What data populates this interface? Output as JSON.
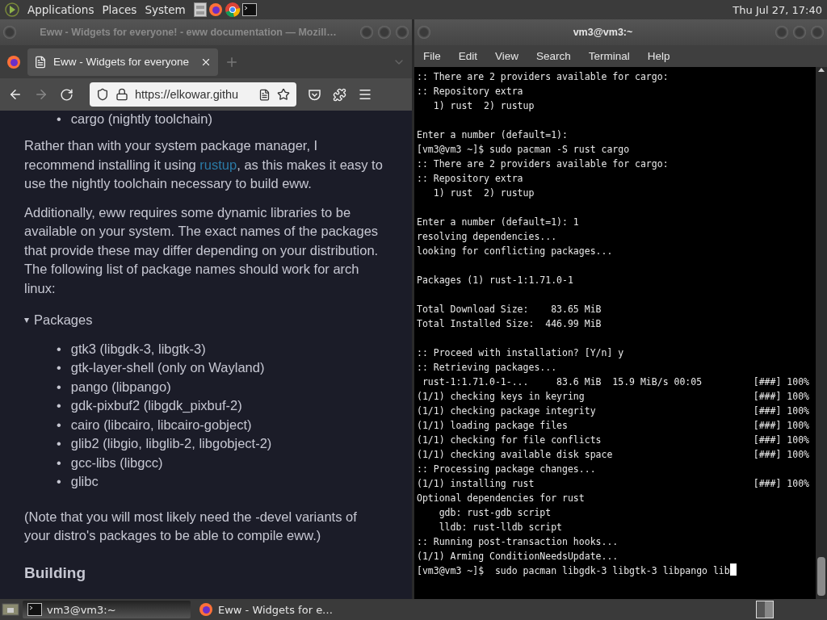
{
  "top_panel": {
    "menus": [
      "Applications",
      "Places",
      "System"
    ],
    "clock": "Thu Jul 27, 17:40"
  },
  "browser": {
    "title": "Eww - Widgets for everyone! - eww documentation — Mozill…",
    "active": false,
    "tab": {
      "label": "Eww - Widgets for everyone",
      "selected": true
    },
    "url": "https://elkowar.githu",
    "content": {
      "cut_item": {
        "marker": "•",
        "text": "cargo (nightly toolchain)"
      },
      "para1": {
        "before": "Rather than with your system package manager, I recommend installing it using ",
        "link": "rustup",
        "after": ", as this makes it easy to use the nightly toolchain necessary to build eww."
      },
      "para2": "Additionally, eww requires some dynamic libraries to be available on your system. The exact names of the packages that provide these may differ depending on your distribution. The following list of package names should work for arch linux:",
      "details": {
        "toggle": "▾",
        "summary": "Packages",
        "expanded": true
      },
      "packages": [
        {
          "marker": "•",
          "text": "gtk3 (libgdk-3, libgtk-3)"
        },
        {
          "marker": "•",
          "text": "gtk-layer-shell (only on Wayland)"
        },
        {
          "marker": "•",
          "text": "pango (libpango)"
        },
        {
          "marker": "•",
          "text": "gdk-pixbuf2 (libgdk_pixbuf-2)"
        },
        {
          "marker": "•",
          "text": "cairo (libcairo, libcairo-gobject)"
        },
        {
          "marker": "•",
          "text": "glib2 (libgio, libglib-2, libgobject-2)"
        },
        {
          "marker": "•",
          "text": "gcc-libs (libgcc)"
        },
        {
          "marker": "•",
          "text": "glibc"
        }
      ],
      "note": "(Note that you will most likely need the -devel variants of your distro's packages to be able to compile eww.)",
      "heading": "Building"
    }
  },
  "terminal": {
    "title": "vm3@vm3:~",
    "active": true,
    "menus": [
      "File",
      "Edit",
      "View",
      "Search",
      "Terminal",
      "Help"
    ],
    "lines": [
      {
        "kind": "text",
        "text": ":: There are 2 providers available for cargo:"
      },
      {
        "kind": "text",
        "text": ":: Repository extra"
      },
      {
        "kind": "text",
        "text": "   1) rust  2) rustup"
      },
      {
        "kind": "blank"
      },
      {
        "kind": "text",
        "text": "Enter a number (default=1):"
      },
      {
        "kind": "text",
        "text": "[vm3@vm3 ~]$ sudo pacman -S rust cargo"
      },
      {
        "kind": "text",
        "text": ":: There are 2 providers available for cargo:"
      },
      {
        "kind": "text",
        "text": ":: Repository extra"
      },
      {
        "kind": "text",
        "text": "   1) rust  2) rustup"
      },
      {
        "kind": "blank"
      },
      {
        "kind": "text",
        "text": "Enter a number (default=1): 1"
      },
      {
        "kind": "text",
        "text": "resolving dependencies..."
      },
      {
        "kind": "text",
        "text": "looking for conflicting packages..."
      },
      {
        "kind": "blank"
      },
      {
        "kind": "text",
        "text": "Packages (1) rust-1:1.71.0-1"
      },
      {
        "kind": "blank"
      },
      {
        "kind": "text",
        "text": "Total Download Size:    83.65 MiB"
      },
      {
        "kind": "text",
        "text": "Total Installed Size:  446.99 MiB"
      },
      {
        "kind": "blank"
      },
      {
        "kind": "text",
        "text": ":: Proceed with installation? [Y/n] y"
      },
      {
        "kind": "text",
        "text": ":: Retrieving packages..."
      },
      {
        "kind": "progress",
        "text": " rust-1:1.71.0-1-...     83.6 MiB  15.9 MiB/s 00:05",
        "progress": "[###] 100%"
      },
      {
        "kind": "progress",
        "text": "(1/1) checking keys in keyring",
        "progress": "[###] 100%"
      },
      {
        "kind": "progress",
        "text": "(1/1) checking package integrity",
        "progress": "[###] 100%"
      },
      {
        "kind": "progress",
        "text": "(1/1) loading package files",
        "progress": "[###] 100%"
      },
      {
        "kind": "progress",
        "text": "(1/1) checking for file conflicts",
        "progress": "[###] 100%"
      },
      {
        "kind": "progress",
        "text": "(1/1) checking available disk space",
        "progress": "[###] 100%"
      },
      {
        "kind": "text",
        "text": ":: Processing package changes..."
      },
      {
        "kind": "progress",
        "text": "(1/1) installing rust",
        "progress": "[###] 100%"
      },
      {
        "kind": "text",
        "text": "Optional dependencies for rust"
      },
      {
        "kind": "text",
        "text": "    gdb: rust-gdb script"
      },
      {
        "kind": "text",
        "text": "    lldb: rust-lldb script"
      },
      {
        "kind": "text",
        "text": ":: Running post-transaction hooks..."
      },
      {
        "kind": "text",
        "text": "(1/1) Arming ConditionNeedsUpdate..."
      },
      {
        "kind": "prompt",
        "text": "[vm3@vm3 ~]$  sudo pacman libgdk-3 libgtk-3 libpango lib"
      }
    ]
  },
  "taskbar": [
    {
      "kind": "terminal",
      "label": "vm3@vm3:~",
      "selected": true
    },
    {
      "kind": "browser",
      "label": "Eww - Widgets for e…",
      "selected": false
    }
  ]
}
